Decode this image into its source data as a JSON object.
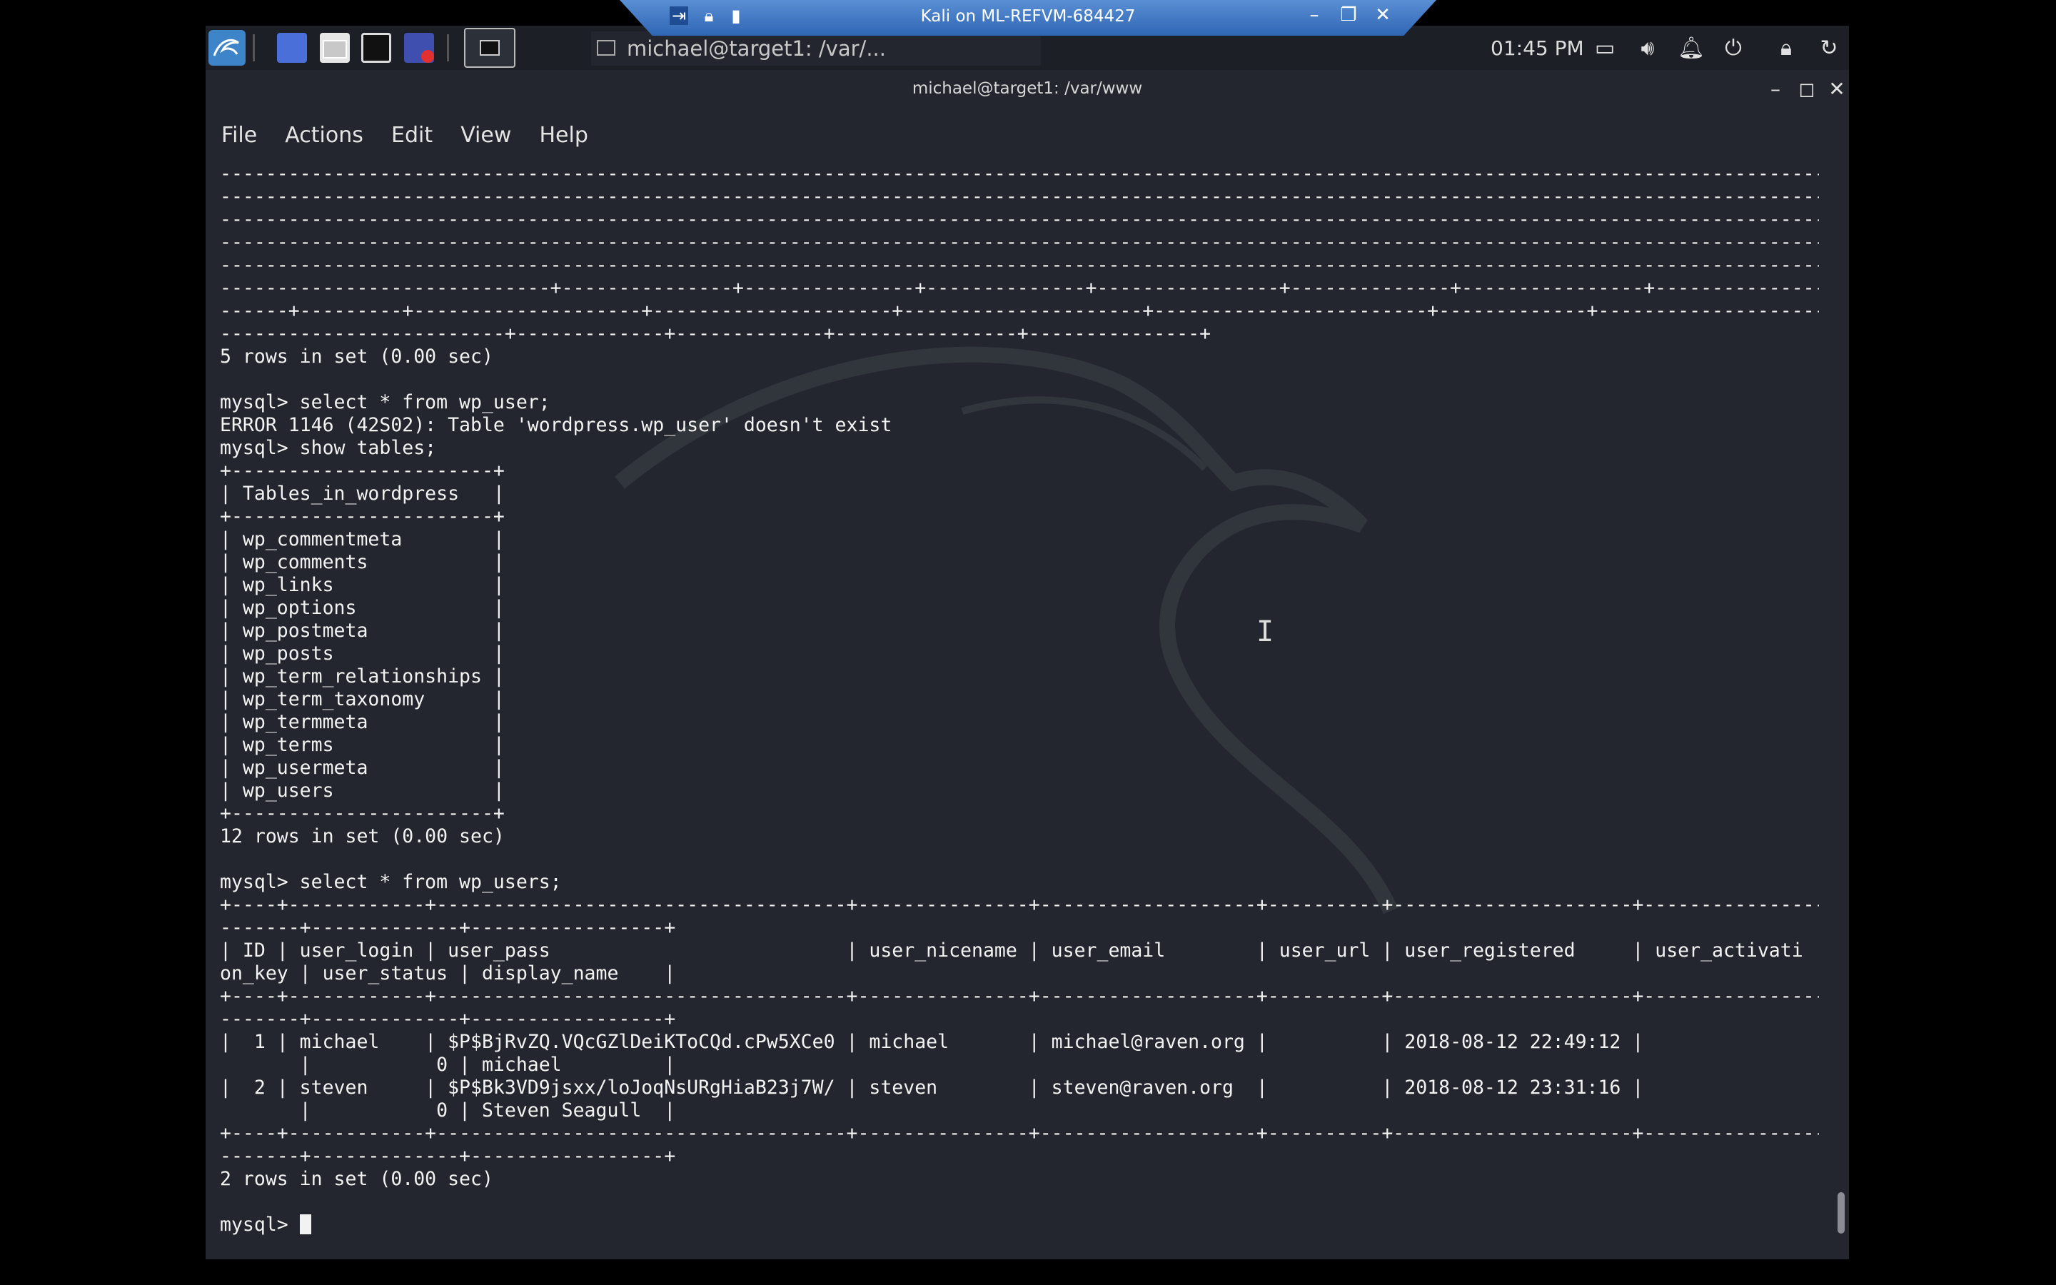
{
  "rdp": {
    "title": "Kali on ML-REFVM-684427",
    "pin_icon": "pin-icon",
    "minimize": "–",
    "restore": "❐",
    "close": "✕"
  },
  "taskbar": {
    "task_label": "michael@target1: /var/...",
    "clock": "01:45 PM"
  },
  "window": {
    "title": "michael@target1: /var/www",
    "minimize": "–",
    "maximize": "◻",
    "close": "✕"
  },
  "menu": [
    "File",
    "Actions",
    "Edit",
    "View",
    "Help"
  ],
  "terminal": {
    "lines": [
      "----------------------------------------------------------------------------------------------------------------------------------------------",
      "----------------------------------------------------------------------------------------------------------------------------------------------",
      "----------------------------------------------------------------------------------------------------------------------------------------------",
      "----------------------------------------------------------------------------------------------------------------------------------------------",
      "----------------------------------------------------------------------------------------------------------------------------------------------",
      "-----------------------------+---------------+---------------+--------------+----------------+--------------+----------------+----------------+---",
      "------+---------+--------------------+---------------------+---------------------+------------------------+-------------+-----------------------",
      "-------------------------+-------------+-------------+----------------+---------------+",
      "5 rows in set (0.00 sec)",
      "",
      "mysql> select * from wp_user;",
      "ERROR 1146 (42S02): Table 'wordpress.wp_user' doesn't exist",
      "mysql> show tables;",
      "+-----------------------+",
      "| Tables_in_wordpress   |",
      "+-----------------------+",
      "| wp_commentmeta        |",
      "| wp_comments           |",
      "| wp_links              |",
      "| wp_options            |",
      "| wp_postmeta           |",
      "| wp_posts              |",
      "| wp_term_relationships |",
      "| wp_term_taxonomy      |",
      "| wp_termmeta           |",
      "| wp_terms              |",
      "| wp_usermeta           |",
      "| wp_users              |",
      "+-----------------------+",
      "12 rows in set (0.00 sec)",
      "",
      "mysql> select * from wp_users;",
      "+----+------------+------------------------------------+---------------+-------------------+----------+---------------------+------------------",
      "-------+-------------+-----------------+",
      "| ID | user_login | user_pass                          | user_nicename | user_email        | user_url | user_registered     | user_activati",
      "on_key | user_status | display_name    |",
      "+----+------------+------------------------------------+---------------+-------------------+----------+---------------------+------------------",
      "-------+-------------+-----------------+",
      "|  1 | michael    | $P$BjRvZQ.VQcGZlDeiKToCQd.cPw5XCe0 | michael       | michael@raven.org |          | 2018-08-12 22:49:12 |",
      "       |           0 | michael         |",
      "|  2 | steven     | $P$Bk3VD9jsxx/loJoqNsURgHiaB23j7W/ | steven        | steven@raven.org  |          | 2018-08-12 23:31:16 |",
      "       |           0 | Steven Seagull  |",
      "+----+------------+------------------------------------+---------------+-------------------+----------+---------------------+------------------",
      "-------+-------------+-----------------+",
      "2 rows in set (0.00 sec)",
      ""
    ],
    "prompt": "mysql> "
  }
}
